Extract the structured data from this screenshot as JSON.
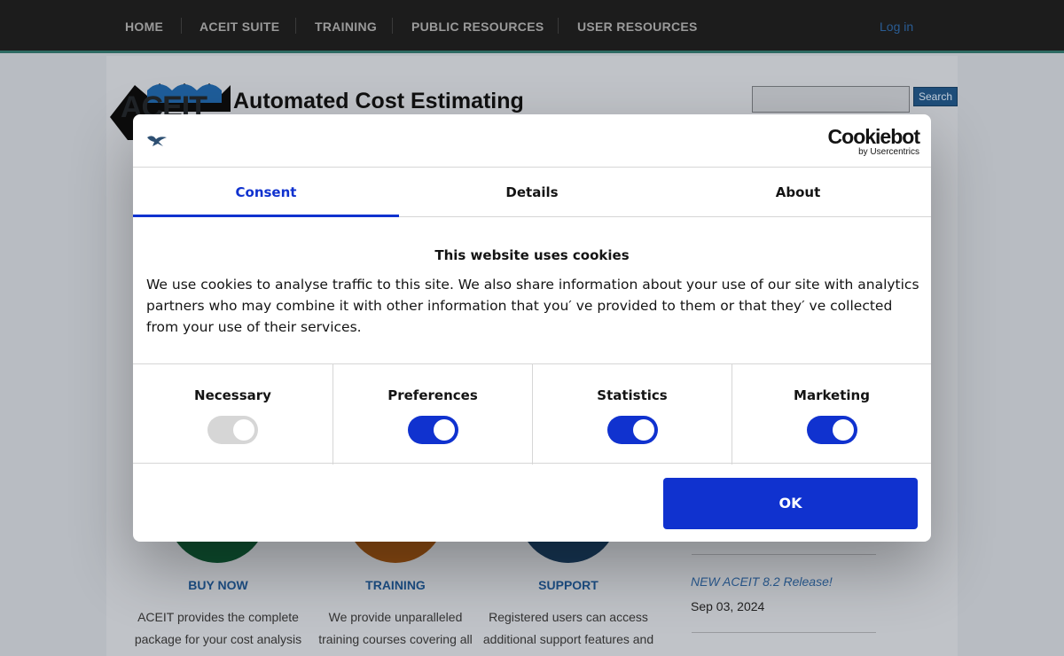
{
  "nav": {
    "items": [
      "HOME",
      "ACEIT SUITE",
      "TRAINING",
      "PUBLIC RESOURCES",
      "USER RESOURCES"
    ],
    "login": "Log in"
  },
  "header": {
    "logo_text": "ACEIT",
    "title": "Automated Cost Estimating",
    "search_button": "Search",
    "search_placeholder": ""
  },
  "features": [
    {
      "title": "BUY NOW",
      "desc": "ACEIT provides the complete package for your cost analysis needs!",
      "color": "#0d4d2e"
    },
    {
      "title": "TRAINING",
      "desc": "We provide unparalleled training courses covering all levels of experience.",
      "color": "#8a4a12"
    },
    {
      "title": "SUPPORT",
      "desc": "Registered users can access additional support features and resources.",
      "color": "#163553"
    }
  ],
  "news": {
    "item_title": "NEW ACEIT 8.2 Release!",
    "item_date": "Sep 03, 2024"
  },
  "cookie_dialog": {
    "brand": "Cookiebot",
    "brand_sub": "by Usercentrics",
    "tabs": [
      "Consent",
      "Details",
      "About"
    ],
    "active_tab": "Consent",
    "heading": "This website uses cookies",
    "text": "We use cookies to analyse traffic to this site. We also share information about your use of our site with analytics partners who may combine it with other information that you′ ve provided to them or that they′ ve collected from your use of their services.",
    "categories": [
      {
        "label": "Necessary",
        "enabled": true,
        "locked": true
      },
      {
        "label": "Preferences",
        "enabled": true,
        "locked": false
      },
      {
        "label": "Statistics",
        "enabled": true,
        "locked": false
      },
      {
        "label": "Marketing",
        "enabled": true,
        "locked": false
      }
    ],
    "ok_label": "OK",
    "accent_color": "#1032cf"
  },
  "icons": [
    "bird-logo-icon"
  ]
}
